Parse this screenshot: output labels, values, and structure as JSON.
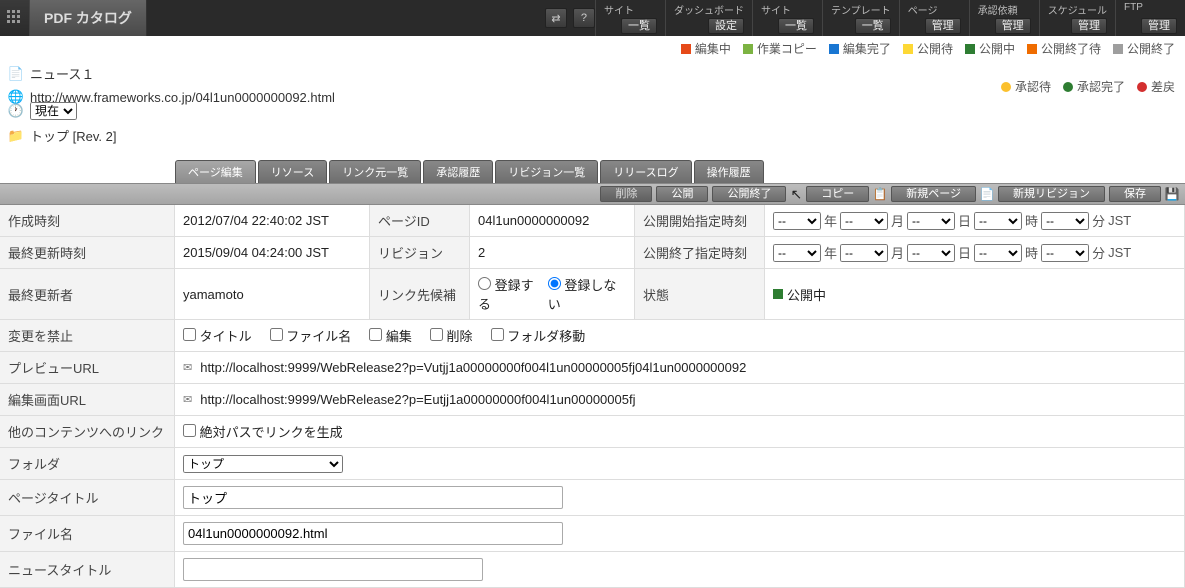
{
  "header": {
    "title": "PDF カタログ",
    "menus": [
      {
        "label": "サイト",
        "btn": "一覧"
      },
      {
        "label": "ダッシュボード",
        "btn": "設定"
      },
      {
        "label": "サイト",
        "btn": "一覧"
      },
      {
        "label": "テンプレート",
        "btn": "一覧"
      },
      {
        "label": "ページ",
        "btn": "管理"
      },
      {
        "label": "承認依頼",
        "btn": "管理"
      },
      {
        "label": "スケジュール",
        "btn": "管理"
      },
      {
        "label": "FTP",
        "btn": "管理"
      }
    ]
  },
  "legend1": [
    {
      "color": "#e64a19",
      "label": "編集中"
    },
    {
      "color": "#7cb342",
      "label": "作業コピー"
    },
    {
      "color": "#1976d2",
      "label": "編集完了"
    },
    {
      "color": "#fdd835",
      "label": "公開待"
    },
    {
      "color": "#2e7d32",
      "label": "公開中"
    },
    {
      "color": "#ef6c00",
      "label": "公開終了待"
    },
    {
      "color": "#9e9e9e",
      "label": "公開終了"
    }
  ],
  "legend2": [
    {
      "color": "#fbc02d",
      "label": "承認待"
    },
    {
      "color": "#2e7d32",
      "label": "承認完了"
    },
    {
      "color": "#d32f2f",
      "label": "差戻"
    }
  ],
  "path": {
    "page_name": "ニュース１",
    "url": "http://www.frameworks.co.jp/04l1un0000000092.html",
    "time_select_value": "現在",
    "folder_rev": "トップ [Rev. 2]"
  },
  "tabs": [
    "ページ編集",
    "リソース",
    "リンク元一覧",
    "承認履歴",
    "リビジョン一覧",
    "リリースログ",
    "操作履歴"
  ],
  "actions": {
    "delete": "削除",
    "publish": "公開",
    "end_publish": "公開終了",
    "copy": "コピー",
    "new_page": "新規ページ",
    "new_revision": "新規リビジョン",
    "save": "保存"
  },
  "form": {
    "labels": {
      "created": "作成時刻",
      "page_id": "ページID",
      "pub_start": "公開開始指定時刻",
      "last_update": "最終更新時刻",
      "revision": "リビジョン",
      "pub_end": "公開終了指定時刻",
      "last_editor": "最終更新者",
      "link_candidate": "リンク先候補",
      "status": "状態",
      "prohibit_change": "変更を禁止",
      "preview_url": "プレビューURL",
      "edit_url": "編集画面URL",
      "other_link": "他のコンテンツへのリンク",
      "folder": "フォルダ",
      "page_title": "ページタイトル",
      "file_name": "ファイル名",
      "news_title": "ニュースタイトル"
    },
    "values": {
      "created": "2012/07/04 22:40:02 JST",
      "page_id": "04l1un0000000092",
      "last_update": "2015/09/04 04:24:00 JST",
      "revision": "2",
      "last_editor": "yamamoto",
      "status_label": "公開中",
      "status_color": "#2e7d32",
      "preview_url": "http://localhost:9999/WebRelease2?p=Vutjj1a00000000f004l1un00000005fj04l1un0000000092",
      "edit_url": "http://localhost:9999/WebRelease2?p=Eutjj1a00000000f004l1un00000005fj",
      "folder_select": "トップ",
      "page_title": "トップ",
      "file_name": "04l1un0000000092.html",
      "news_title": ""
    },
    "radios": {
      "register": "登録する",
      "not_register": "登録しない"
    },
    "checkboxes": {
      "title": "タイトル",
      "file_name": "ファイル名",
      "edit": "編集",
      "delete": "削除",
      "folder_move": "フォルダ移動",
      "abs_path": "絶対パスでリンクを生成"
    },
    "dt_units": {
      "year": "年",
      "month": "月",
      "day": "日",
      "hour": "時",
      "min": "分",
      "tz": "JST",
      "dash": "--"
    }
  }
}
